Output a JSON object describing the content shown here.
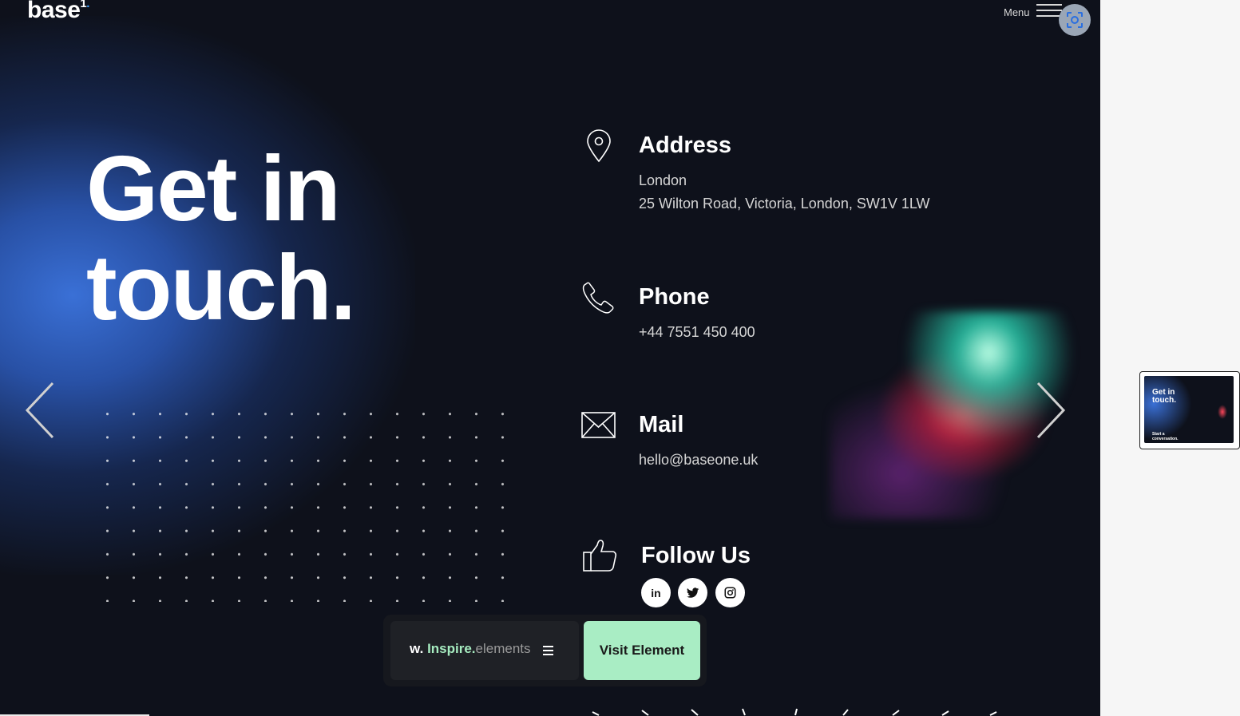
{
  "header": {
    "logo_text": "base",
    "logo_sup": "1",
    "menu_label": "Menu"
  },
  "hero": {
    "line1": "Get in",
    "line2": "touch."
  },
  "contact": {
    "address": {
      "title": "Address",
      "city": "London",
      "street": "25 Wilton Road, Victoria, London, SW1V 1LW"
    },
    "phone": {
      "title": "Phone",
      "number": "+44 7551 450 400"
    },
    "mail": {
      "title": "Mail",
      "email": "hello@baseone.uk"
    },
    "follow": {
      "title": "Follow Us",
      "networks": [
        "in",
        "twitter-icon",
        "instagram-icon"
      ]
    }
  },
  "bottom_bar": {
    "brand_w": "w.",
    "brand_inspire": "Inspire.",
    "brand_elements": "elements",
    "visit_label": "Visit Element"
  },
  "thumbnail": {
    "title_line1": "Get in",
    "title_line2": "touch.",
    "subtitle_line1": "Start a",
    "subtitle_line2": "conversation."
  },
  "colors": {
    "background": "#0e111b",
    "accent_green": "#a9edc4",
    "brand_inspire": "#a6ecc0",
    "logo_dot": "#3aa0ff"
  }
}
